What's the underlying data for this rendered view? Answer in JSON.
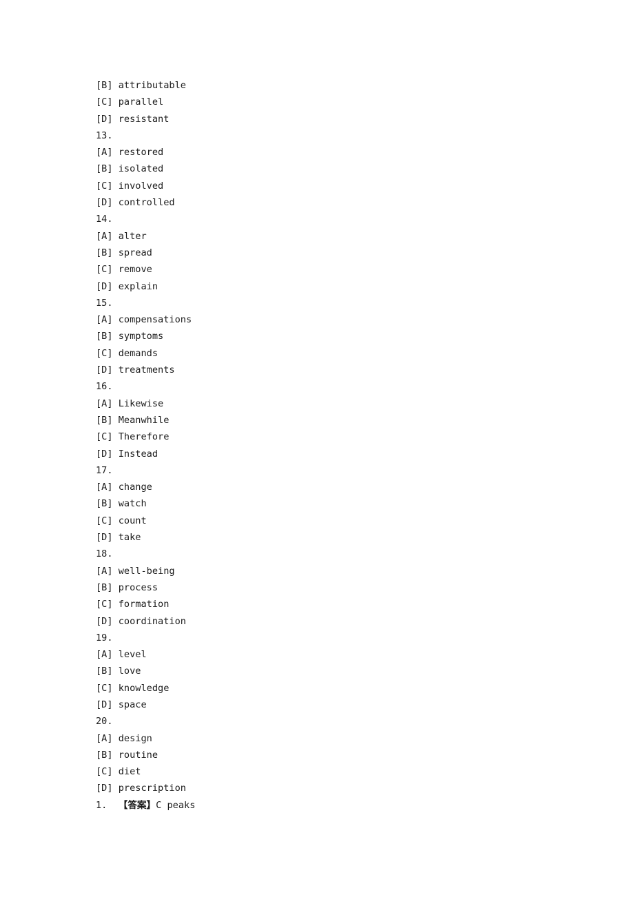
{
  "document": {
    "page_background": "#ffffff",
    "text_color": "#1c1c1c",
    "lines": [
      {
        "id": "opt-12-B",
        "type": "option",
        "text": "[B] attributable"
      },
      {
        "id": "opt-12-C",
        "type": "option",
        "text": "[C] parallel"
      },
      {
        "id": "opt-12-D",
        "type": "option",
        "text": "[D] resistant"
      },
      {
        "id": "q-13",
        "type": "number",
        "text": "13."
      },
      {
        "id": "opt-13-A",
        "type": "option",
        "text": "[A] restored"
      },
      {
        "id": "opt-13-B",
        "type": "option",
        "text": "[B] isolated"
      },
      {
        "id": "opt-13-C",
        "type": "option",
        "text": "[C] involved"
      },
      {
        "id": "opt-13-D",
        "type": "option",
        "text": "[D] controlled"
      },
      {
        "id": "q-14",
        "type": "number",
        "text": "14."
      },
      {
        "id": "opt-14-A",
        "type": "option",
        "text": "[A] alter"
      },
      {
        "id": "opt-14-B",
        "type": "option",
        "text": "[B] spread"
      },
      {
        "id": "opt-14-C",
        "type": "option",
        "text": "[C] remove"
      },
      {
        "id": "opt-14-D",
        "type": "option",
        "text": "[D] explain"
      },
      {
        "id": "q-15",
        "type": "number",
        "text": "15."
      },
      {
        "id": "opt-15-A",
        "type": "option",
        "text": "[A] compensations"
      },
      {
        "id": "opt-15-B",
        "type": "option",
        "text": "[B] symptoms"
      },
      {
        "id": "opt-15-C",
        "type": "option",
        "text": "[C] demands"
      },
      {
        "id": "opt-15-D",
        "type": "option",
        "text": "[D] treatments"
      },
      {
        "id": "q-16",
        "type": "number",
        "text": "16."
      },
      {
        "id": "opt-16-A",
        "type": "option",
        "text": "[A] Likewise"
      },
      {
        "id": "opt-16-B",
        "type": "option",
        "text": "[B] Meanwhile"
      },
      {
        "id": "opt-16-C",
        "type": "option",
        "text": "[C] Therefore"
      },
      {
        "id": "opt-16-D",
        "type": "option",
        "text": "[D] Instead"
      },
      {
        "id": "q-17",
        "type": "number",
        "text": "17."
      },
      {
        "id": "opt-17-A",
        "type": "option",
        "text": "[A] change"
      },
      {
        "id": "opt-17-B",
        "type": "option",
        "text": "[B] watch"
      },
      {
        "id": "opt-17-C",
        "type": "option",
        "text": "[C] count"
      },
      {
        "id": "opt-17-D",
        "type": "option",
        "text": "[D] take"
      },
      {
        "id": "q-18",
        "type": "number",
        "text": "18."
      },
      {
        "id": "opt-18-A",
        "type": "option",
        "text": "[A] well-being"
      },
      {
        "id": "opt-18-B",
        "type": "option",
        "text": "[B] process"
      },
      {
        "id": "opt-18-C",
        "type": "option",
        "text": "[C] formation"
      },
      {
        "id": "opt-18-D",
        "type": "option",
        "text": "[D] coordination"
      },
      {
        "id": "q-19",
        "type": "number",
        "text": "19."
      },
      {
        "id": "opt-19-A",
        "type": "option",
        "text": "[A] level"
      },
      {
        "id": "opt-19-B",
        "type": "option",
        "text": "[B] love"
      },
      {
        "id": "opt-19-C",
        "type": "option",
        "text": "[C] knowledge"
      },
      {
        "id": "opt-19-D",
        "type": "option",
        "text": "[D] space"
      },
      {
        "id": "q-20",
        "type": "number",
        "text": "20."
      },
      {
        "id": "opt-20-A",
        "type": "option",
        "text": "[A] design"
      },
      {
        "id": "opt-20-B",
        "type": "option",
        "text": "[B] routine"
      },
      {
        "id": "opt-20-C",
        "type": "option",
        "text": "[C] diet"
      },
      {
        "id": "opt-20-D",
        "type": "option",
        "text": "[D] prescription"
      }
    ],
    "answer_key_line": {
      "id": "answer-1",
      "number": "1.",
      "spacer": "  ",
      "label": "【答案】",
      "answer": "C peaks"
    }
  }
}
